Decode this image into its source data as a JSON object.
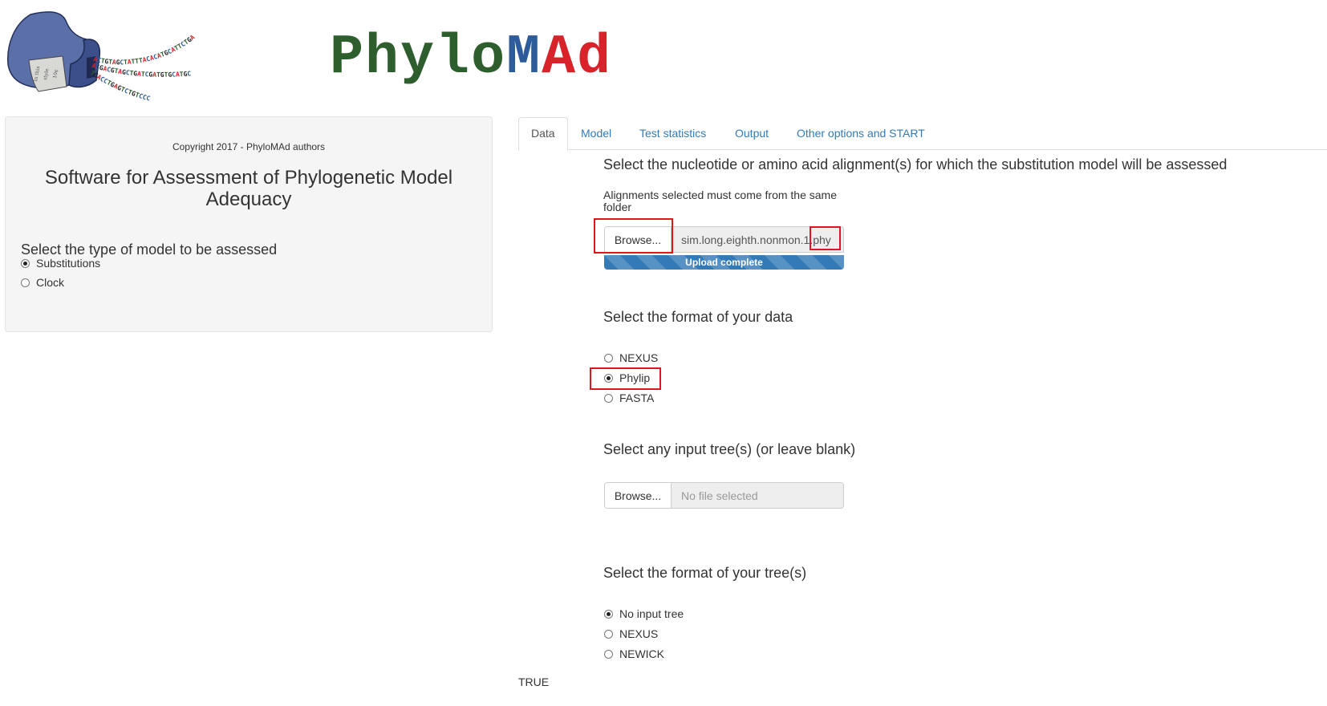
{
  "logo": {
    "title_letters": [
      {
        "char": "P",
        "color": "#2e5e2e"
      },
      {
        "char": "h",
        "color": "#2e5e2e"
      },
      {
        "char": "y",
        "color": "#2e5e2e"
      },
      {
        "char": "l",
        "color": "#2e5e2e"
      },
      {
        "char": "o",
        "color": "#2e5e2e"
      },
      {
        "char": "M",
        "color": "#2e5c9a"
      },
      {
        "char": "A",
        "color": "#d9232a"
      },
      {
        "char": "d",
        "color": "#d9232a"
      }
    ],
    "art_icon": "dna-sequencing-machine-icon",
    "sequences": [
      "ACTGTAGCTATTTACACATGCATTCTGA",
      "ACGACGTAGCTGATCGATGTGCATGC",
      "TGACCTGAGTCTGTCCC"
    ],
    "label_lines": [
      "In this",
      "style",
      "10¢"
    ]
  },
  "sidebar": {
    "copyright": "Copyright 2017 - PhyloMAd authors",
    "title": "Software for Assessment of Phylogenetic Model Adequacy",
    "model_type_label": "Select the type of model to be assessed",
    "model_options": [
      {
        "label": "Substitutions",
        "checked": true
      },
      {
        "label": "Clock",
        "checked": false
      }
    ]
  },
  "tabs": [
    {
      "label": "Data",
      "active": true
    },
    {
      "label": "Model",
      "active": false
    },
    {
      "label": "Test statistics",
      "active": false
    },
    {
      "label": "Output",
      "active": false
    },
    {
      "label": "Other options and START",
      "active": false
    }
  ],
  "data_tab": {
    "alignment_heading": "Select the nucleotide or amino acid alignment(s) for which the substitution model will be assessed",
    "alignment_note": "Alignments selected must come from the same folder",
    "alignment_input": {
      "browse_label": "Browse...",
      "value": "sim.long.eighth.nonmon.1.phy",
      "value_main": "sim.long.eighth.nonmon.1",
      "value_ext": "phy",
      "progress_label": "Upload complete",
      "progress_percent": 100
    },
    "data_format_heading": "Select the format of your data",
    "data_format_options": [
      {
        "label": "NEXUS",
        "checked": false
      },
      {
        "label": "Phylip",
        "checked": true
      },
      {
        "label": "FASTA",
        "checked": false
      }
    ],
    "tree_heading": "Select any input tree(s) (or leave blank)",
    "tree_input": {
      "browse_label": "Browse...",
      "placeholder": "No file selected"
    },
    "tree_format_heading": "Select the format of your tree(s)",
    "tree_format_options": [
      {
        "label": "No input tree",
        "checked": true
      },
      {
        "label": "NEXUS",
        "checked": false
      },
      {
        "label": "NEWICK",
        "checked": false
      }
    ]
  },
  "footer_output": "TRUE",
  "annotation_color": "#e0161e"
}
